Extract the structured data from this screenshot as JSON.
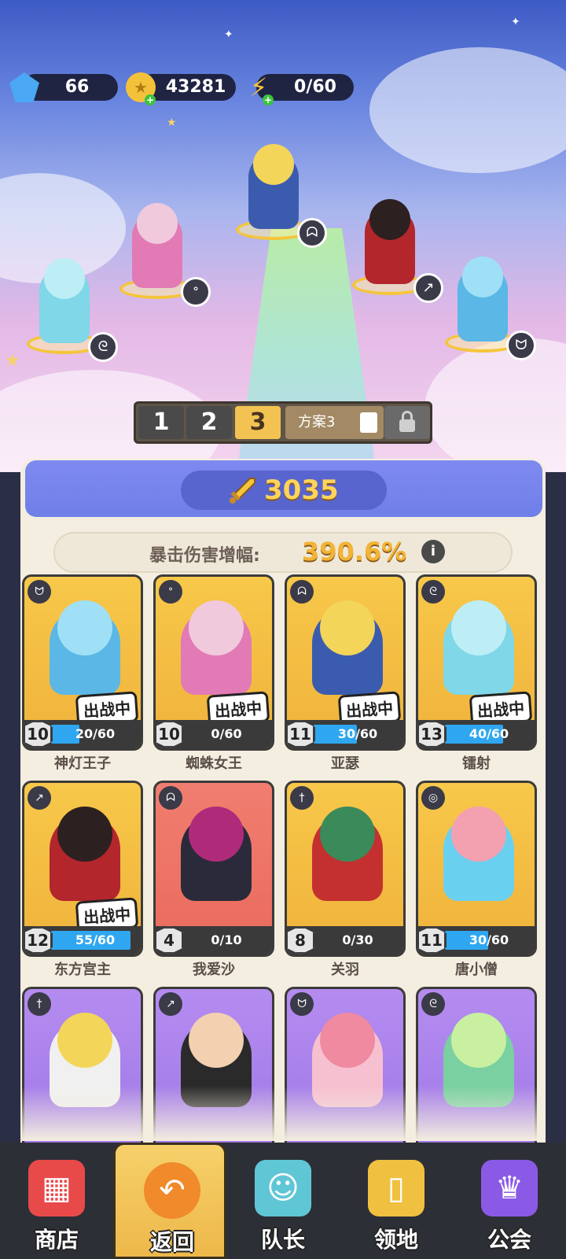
{
  "resources": {
    "gems": "66",
    "gold": "43281",
    "energy": "0/60"
  },
  "plans": {
    "buttons": [
      "1",
      "2",
      "3"
    ],
    "active": "3",
    "name": "方案3"
  },
  "team": {
    "power": "3035",
    "crit_label": "暴击伤害增幅:",
    "crit_value": "390.6%"
  },
  "heroes": [
    {
      "name": "神灯王子",
      "level": "10",
      "xp": "20/60",
      "xp_fill": 0.33,
      "in_battle": true,
      "battle_label": "出战中",
      "class_icon": "wings-icon",
      "card_color": "gold"
    },
    {
      "name": "蜘蛛女王",
      "level": "10",
      "xp": "0/60",
      "xp_fill": 0,
      "in_battle": true,
      "battle_label": "出战中",
      "class_icon": "potion-icon",
      "card_color": "gold"
    },
    {
      "name": "亚瑟",
      "level": "11",
      "xp": "30/60",
      "xp_fill": 0.5,
      "in_battle": true,
      "battle_label": "出战中",
      "class_icon": "bull-icon",
      "card_color": "gold"
    },
    {
      "name": "镭射",
      "level": "13",
      "xp": "40/60",
      "xp_fill": 0.67,
      "in_battle": true,
      "battle_label": "出战中",
      "class_icon": "staff-icon",
      "card_color": "gold"
    },
    {
      "name": "东方宫主",
      "level": "12",
      "xp": "55/60",
      "xp_fill": 0.92,
      "in_battle": true,
      "battle_label": "出战中",
      "class_icon": "bow-icon",
      "card_color": "gold"
    },
    {
      "name": "我爱沙",
      "level": "4",
      "xp": "0/10",
      "xp_fill": 0,
      "in_battle": false,
      "battle_label": "",
      "class_icon": "bull-icon",
      "card_color": "red"
    },
    {
      "name": "关羽",
      "level": "8",
      "xp": "0/30",
      "xp_fill": 0,
      "in_battle": false,
      "battle_label": "",
      "class_icon": "sword-icon",
      "card_color": "gold"
    },
    {
      "name": "唐小僧",
      "level": "11",
      "xp": "30/60",
      "xp_fill": 0.5,
      "in_battle": false,
      "battle_label": "",
      "class_icon": "swirl-icon",
      "card_color": "gold"
    },
    {
      "name": "",
      "level": "",
      "xp": "",
      "xp_fill": 0,
      "in_battle": false,
      "battle_label": "",
      "class_icon": "sword-icon",
      "card_color": "purple"
    },
    {
      "name": "",
      "level": "",
      "xp": "",
      "xp_fill": 0,
      "in_battle": false,
      "battle_label": "",
      "class_icon": "bow-icon",
      "card_color": "purple"
    },
    {
      "name": "",
      "level": "",
      "xp": "",
      "xp_fill": 0,
      "in_battle": false,
      "battle_label": "",
      "class_icon": "wings-icon",
      "card_color": "purple"
    },
    {
      "name": "",
      "level": "",
      "xp": "",
      "xp_fill": 0,
      "in_battle": false,
      "battle_label": "",
      "class_icon": "staff-icon",
      "card_color": "purple"
    }
  ],
  "nav": {
    "items": [
      {
        "label": "商店",
        "icon": "shop-icon"
      },
      {
        "label": "返回",
        "icon": "back-icon"
      },
      {
        "label": "队长",
        "icon": "captain-icon"
      },
      {
        "label": "领地",
        "icon": "territory-icon"
      },
      {
        "label": "公会",
        "icon": "guild-icon"
      }
    ],
    "active": "返回"
  },
  "colors": {
    "accent_gold": "#f2c352",
    "power_text": "#ffd45a",
    "xp_fill": "#2fa7f0",
    "nav_bg": "#2d2f36"
  }
}
